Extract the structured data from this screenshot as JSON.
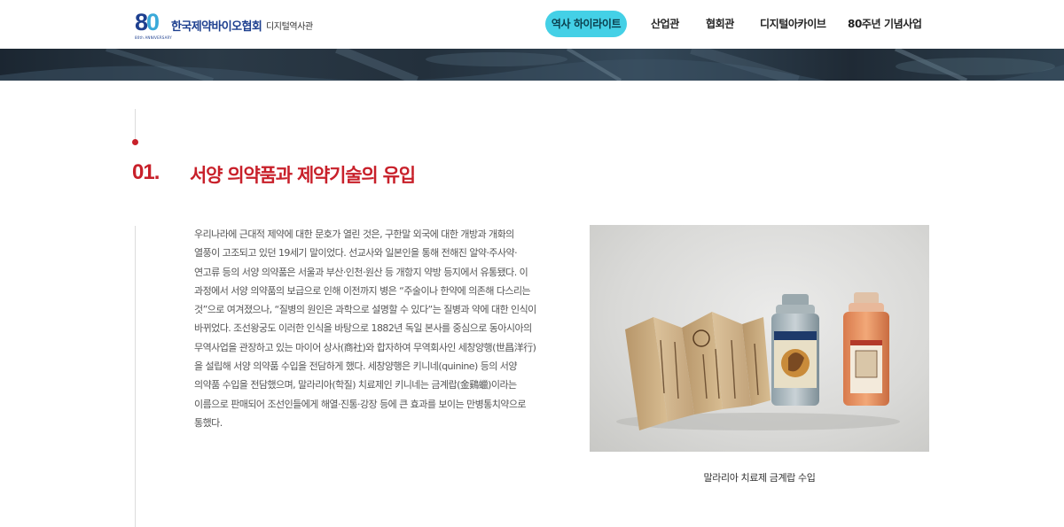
{
  "header": {
    "logo_number": "80",
    "logo_subtitle": "80th ANNIVERSARY",
    "org_name": "한국제약바이오협회",
    "org_sub": "디지털역사관",
    "nav": [
      {
        "label": "역사 하이라이트",
        "active": true
      },
      {
        "label": "산업관",
        "active": false
      },
      {
        "label": "협회관",
        "active": false
      },
      {
        "label": "디지털아카이브",
        "active": false
      },
      {
        "label": "80주년 기념사업",
        "active": false
      }
    ]
  },
  "section": {
    "number": "01.",
    "title": "서양 의약품과 제약기술의 유입",
    "body": "우리나라에 근대적 제약에 대한 문호가 열린 것은, 구한말 외국에 대한 개방과 개화의 열풍이 고조되고 있던 19세기 말이었다. 선교사와 일본인을 통해 전해진 알약·주사약·연고류 등의 서양 의약품은 서울과 부산·인천·원산 등 개항지 약방 등지에서 유통됐다. 이 과정에서 서양 의약품의 보급으로 인해 이전까지 병은 “주술이나 한약에 의존해 다스리는 것”으로 여겨졌으나, “질병의 원인은 과학으로 설명할 수 있다”는 질병과 약에 대한 인식이 바뀌었다. 조선왕궁도 이러한 인식을 바탕으로 1882년 독일 본사를 중심으로 동아시아의 무역사업을 관장하고 있는 마이어 상사(商社)와 합자하여 무역회사인 세창양행(世昌洋行)을 설립해 서양 의약품 수입을 전담하게 했다. 세창양행은 키니네(quinine) 등의 서양 의약품 수입을 전담했으며, 말라리아(학질) 치료제인 키니네는 금계랍(金鷄蠟)이라는 이름으로 판매되어 조선인들에게 해열·진통·강장 등에 큰 효과를 보이는 만병통치약으로 통했다.",
    "image_caption": "말라리아 치료제 금계랍 수입"
  },
  "colors": {
    "accent_red": "#c8202a",
    "nav_active": "#44d0e6",
    "brand_blue": "#1d3f8f"
  }
}
